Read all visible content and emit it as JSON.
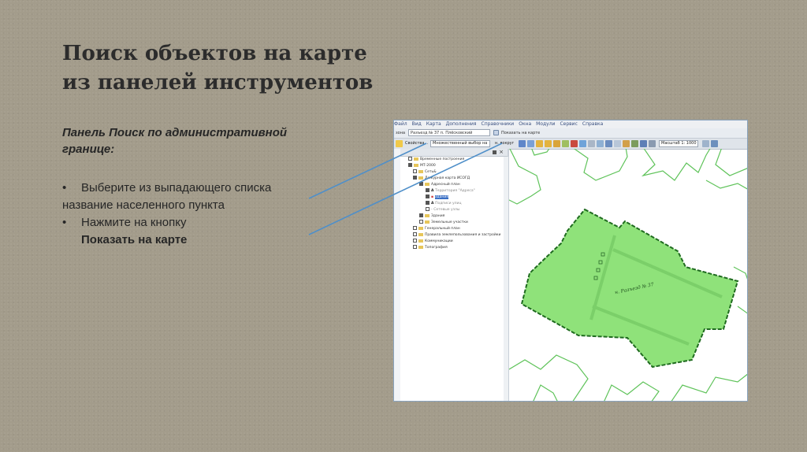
{
  "slide": {
    "title_line1": "Поиск объектов на карте",
    "title_line2": "из панелей инструментов",
    "caption_line1": "Панель Поиск по административной",
    "caption_line2": "границе:",
    "step1_bullet": "•",
    "step1_line1": "Выберите из выпадающего списка",
    "step1_line2": "название населенного пункта",
    "step2_bullet": "•",
    "step2_line1": "Нажмите на кнопку",
    "step2_strong": "Показать на карте"
  },
  "app": {
    "menu": [
      "Файл",
      "Вид",
      "Карта",
      "Дополнения",
      "Справочники",
      "Окна",
      "Модули",
      "Сервис",
      "Справка"
    ],
    "search_toolbar": {
      "label": "зона",
      "field_value": "Разъезд № 37 п. Плёсковский",
      "show_button": "Показать на карте"
    },
    "main_toolbar": {
      "properties_label": "Свойства...",
      "selection_field": "Множественный выбор на",
      "intersect_label": "н. вокруг",
      "scale_label": "Масштаб 1: 1000"
    },
    "layer_tree": [
      "Временные построения",
      "МТ-2000",
      "Сеть&",
      "Дежурная карта ИСОГД",
      "Адресный план",
      "Территория \"Адреса\"",
      "Здания",
      "Подписи улиц",
      "Сетевые узлы",
      "Здания",
      "Земельные участки",
      "Генеральный план",
      "Правила землепользования и застройки",
      "Коммуникации",
      "Топография"
    ],
    "map_label": "н. Разъезд № 37"
  },
  "colors": {
    "slide_bg": "#a39c8b",
    "arrow": "#4f8fc9",
    "polygon_fill": "#8fe27a",
    "polygon_stroke": "#1f6b1f",
    "parcel_line": "#5fc35a"
  }
}
